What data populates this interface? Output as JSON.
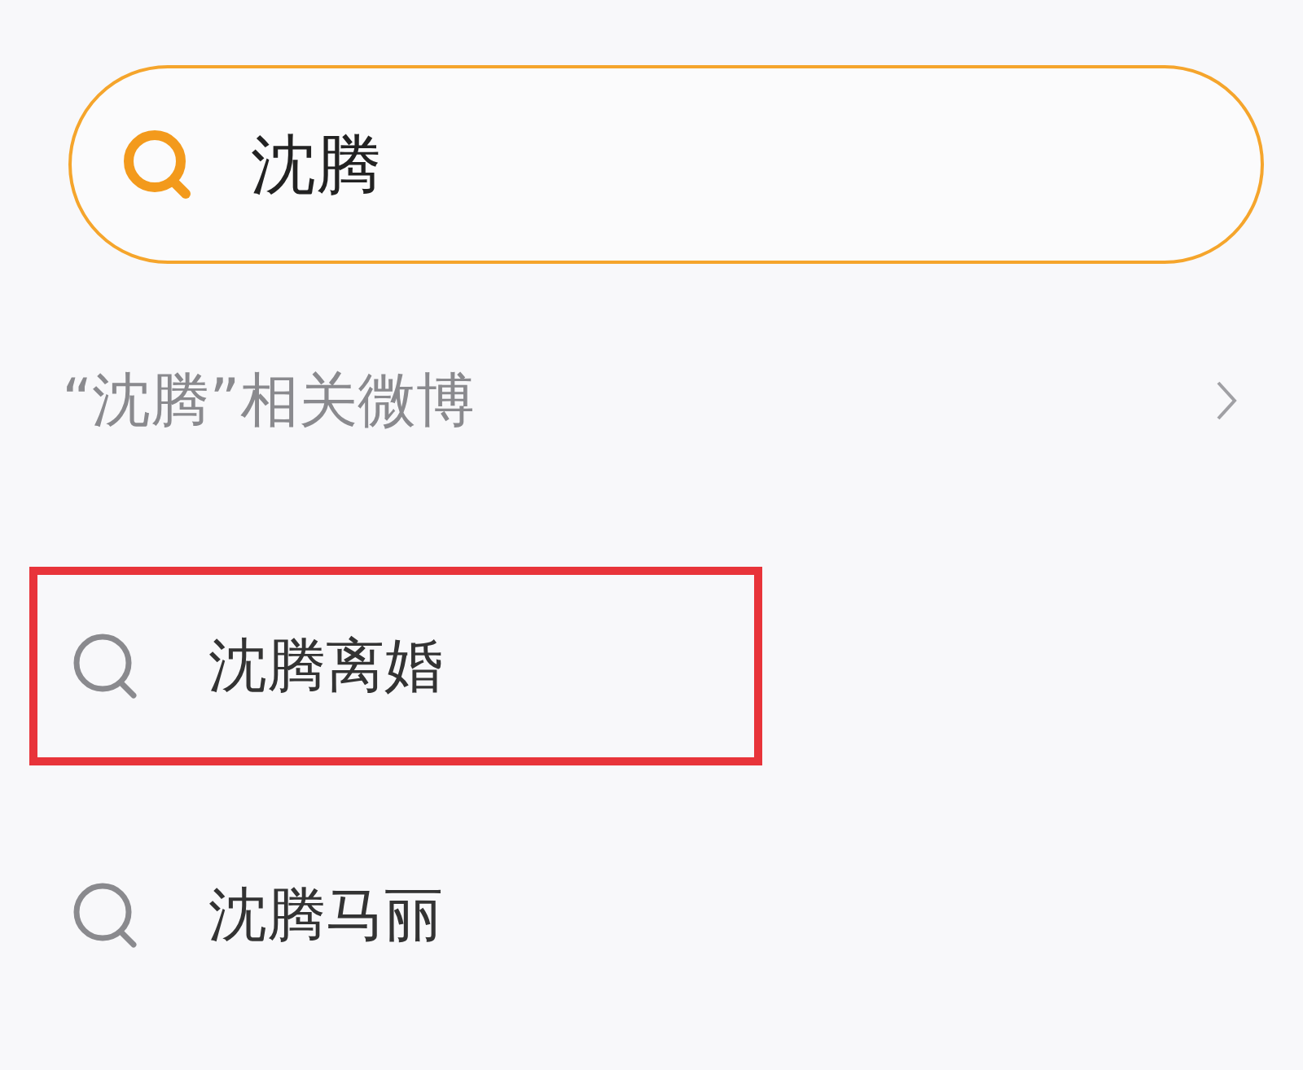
{
  "search": {
    "value": "沈腾"
  },
  "related": {
    "label": "“沈腾”相关微博"
  },
  "suggestions": [
    {
      "text": "沈腾离婚",
      "highlighted": true
    },
    {
      "text": "沈腾马丽",
      "highlighted": false
    }
  ]
}
